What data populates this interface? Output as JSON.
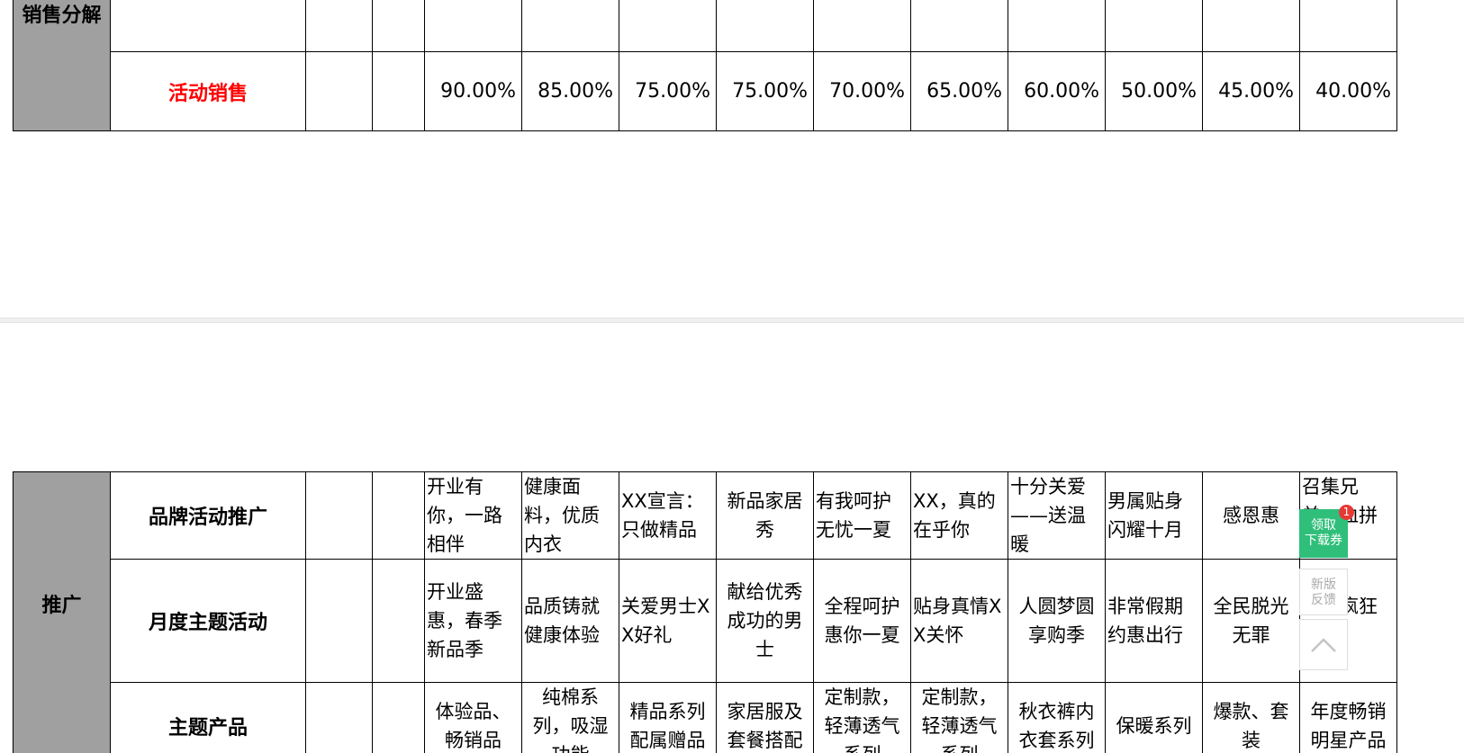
{
  "section1": {
    "group_label": "销售分解",
    "row_label": "活动销售",
    "percentages": [
      "90.00%",
      "85.00%",
      "75.00%",
      "75.00%",
      "70.00%",
      "65.00%",
      "60.00%",
      "50.00%",
      "45.00%",
      "40.00%"
    ]
  },
  "section2": {
    "group_label": "推广",
    "rows": [
      {
        "label": "品牌活动推广",
        "cells": [
          "开业有你，一路相伴",
          "健康面料，优质内衣",
          "XX宣言：只做精品",
          "新品家居秀",
          "有我呵护无忧一夏",
          "XX，真的在乎你",
          "十分关爱——送温暖",
          "男属贴身闪耀十月",
          "感恩惠",
          "召集兄弟，血拼有您"
        ]
      },
      {
        "label": "月度主题活动",
        "cells": [
          "开业盛惠，春季新品季",
          "品质铸就健康体验",
          "关爱男士XX好礼",
          "献给优秀成功的男士",
          "全程呵护惠你一夏",
          "贴身真情XX关怀",
          "人圆梦圆享购季",
          "非常假期约惠出行",
          "全民脱光无罪",
          "圣诞疯狂购"
        ]
      },
      {
        "label": "主题产品",
        "cells": [
          "体验品、畅销品",
          "纯棉系列，吸湿功能",
          "精品系列配属赠品",
          "家居服及套餐搭配",
          "定制款，轻薄透气系列",
          "定制款，轻薄透气系列",
          "秋衣裤内衣套系列",
          "保暖系列",
          "爆款、套装",
          "年度畅销明星产品"
        ]
      }
    ]
  },
  "widgets": {
    "coupon_line1": "领取",
    "coupon_line2": "下载券",
    "coupon_badge": "1",
    "feedback_line1": "新版",
    "feedback_line2": "反馈",
    "back_to_top_icon": "chevron-up-icon"
  }
}
